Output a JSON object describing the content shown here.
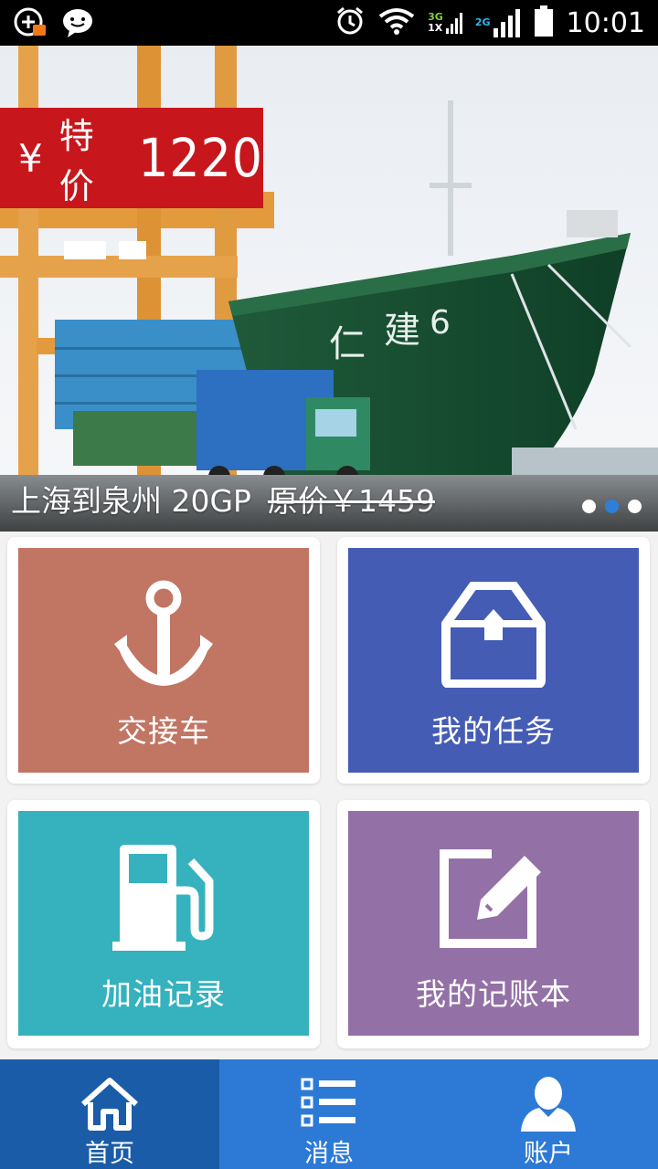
{
  "status_bar": {
    "time": "10:01",
    "network_top": "3G",
    "network_bottom": "1X",
    "network_second": "2G"
  },
  "banner": {
    "price_symbol": "¥",
    "price_label": "特价",
    "price_value": "1220",
    "route_text": "上海到泉州 20GP",
    "original_price": "原价￥1459",
    "slide_count": 3,
    "active_slide": 2
  },
  "tiles": [
    {
      "label": "交接车",
      "icon": "anchor-icon",
      "color": "#c17563"
    },
    {
      "label": "我的任务",
      "icon": "inbox-tray-icon",
      "color": "#455cb5"
    },
    {
      "label": "加油记录",
      "icon": "fuel-pump-icon",
      "color": "#35b2bd"
    },
    {
      "label": "我的记账本",
      "icon": "edit-note-icon",
      "color": "#9370a6"
    }
  ],
  "nav": {
    "items": [
      {
        "label": "首页",
        "icon": "home-icon",
        "active": true
      },
      {
        "label": "消息",
        "icon": "list-icon",
        "active": false
      },
      {
        "label": "账户",
        "icon": "user-icon",
        "active": false
      }
    ],
    "bar_color": "#2d7ad6",
    "active_color": "#1a5ca8"
  }
}
